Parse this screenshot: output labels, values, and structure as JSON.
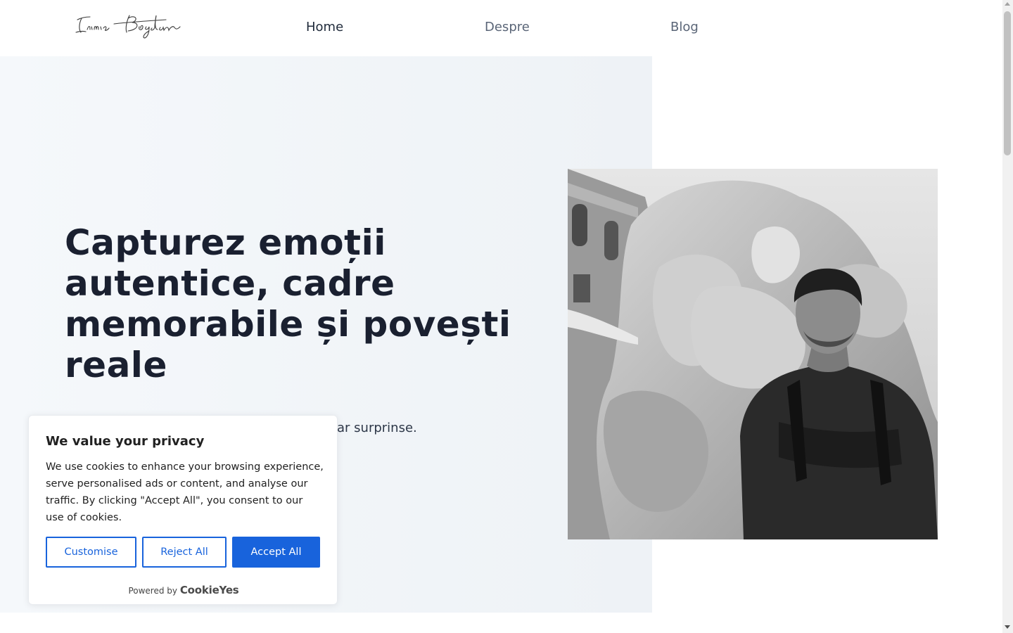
{
  "brand": {
    "logo_text": "Irimia Bogdan"
  },
  "nav": {
    "items": [
      {
        "label": "Home",
        "active": true
      },
      {
        "label": "Despre",
        "active": false
      },
      {
        "label": "Blog",
        "active": false
      }
    ]
  },
  "hero": {
    "title": "Capturez emoții autentice, cadre memorabile și povești reale",
    "subtitle_visible": "ar surprinse."
  },
  "cookie_banner": {
    "title": "We value your privacy",
    "body": "We use cookies to enhance your browsing experience, serve personalised ads or content, and analyse our traffic. By clicking \"Accept All\", you consent to our use of cookies.",
    "customise_label": "Customise",
    "reject_label": "Reject All",
    "accept_label": "Accept All",
    "powered_prefix": "Powered by",
    "powered_brand": "CookieYes",
    "accent_color": "#1863dc"
  },
  "icons": {
    "scroll_up": "arrow-up-icon",
    "scroll_down": "arrow-down-icon"
  }
}
